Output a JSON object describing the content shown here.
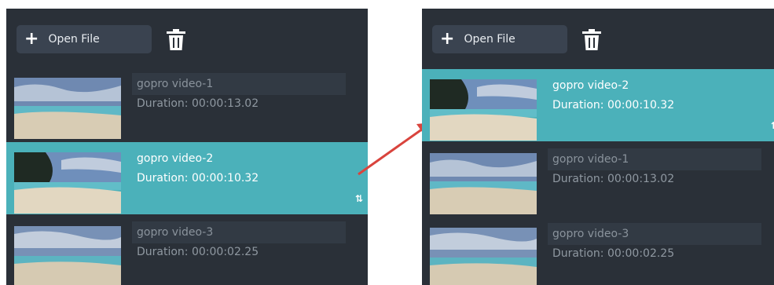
{
  "toolbar": {
    "open_file_label": "Open File",
    "open_file_icon": "+"
  },
  "before": {
    "items": [
      {
        "name": "gopro video-1",
        "duration": "Duration: 00:00:13.02",
        "selected": false
      },
      {
        "name": "gopro video-2",
        "duration": "Duration: 00:00:10.32",
        "selected": true
      },
      {
        "name": "gopro video-3",
        "duration": "Duration: 00:00:02.25",
        "selected": false
      }
    ]
  },
  "after": {
    "items": [
      {
        "name": "gopro video-2",
        "duration": "Duration: 00:00:10.32",
        "selected": true
      },
      {
        "name": "gopro video-1",
        "duration": "Duration: 00:00:13.02",
        "selected": false
      },
      {
        "name": "gopro video-3",
        "duration": "Duration: 00:00:02.25",
        "selected": false
      }
    ]
  },
  "icons": {
    "add": "plus-icon",
    "delete": "trash-icon",
    "reorder": "reorder-arrows-icon",
    "annotation": "red-arrow"
  },
  "reorder_glyph": "⇅",
  "colors": {
    "panel": "#2a3038",
    "selected": "#4bb1ba",
    "arrow": "#d9443d"
  }
}
